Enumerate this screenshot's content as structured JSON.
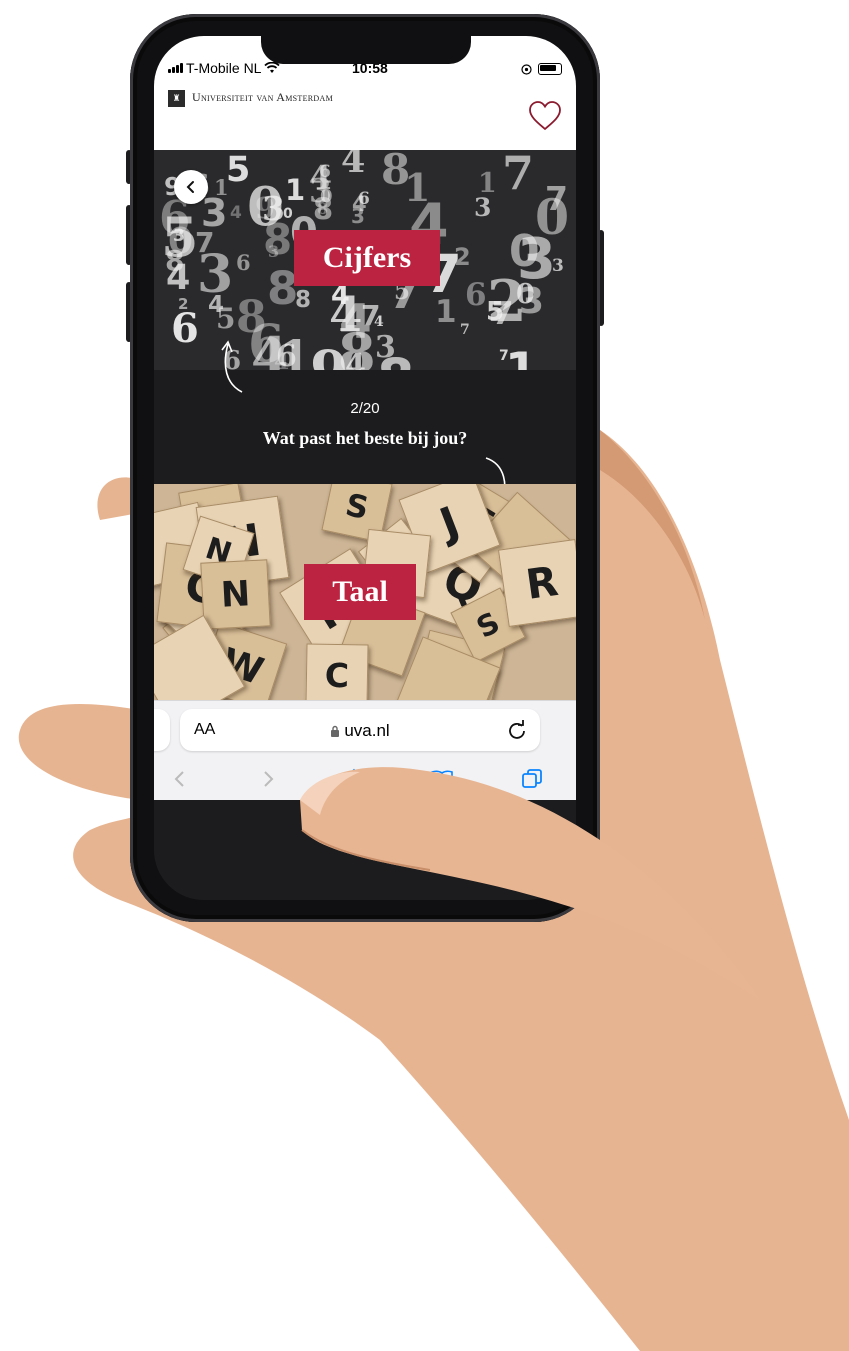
{
  "status_bar": {
    "carrier": "T-Mobile NL",
    "time": "10:58"
  },
  "header": {
    "logo_text": "Universiteit van Amsterdam",
    "logo_mark": "♜",
    "favorite_icon": "heart-icon"
  },
  "quiz": {
    "counter": "2/20",
    "question": "Wat past het beste bij jou?",
    "option_a": {
      "label": "Cijfers",
      "background": "numbers-image"
    },
    "option_b": {
      "label": "Taal",
      "background": "scrabble-tiles-image"
    },
    "back_icon": "chevron-left-icon"
  },
  "browser": {
    "text_size_label": "AA",
    "url": "uva.nl",
    "lock_icon": "lock-icon",
    "reload_icon": "reload-icon",
    "toolbar": [
      "back-icon",
      "forward-icon",
      "share-icon",
      "bookmarks-icon",
      "tabs-icon"
    ]
  },
  "colors": {
    "accent": "#bc2340",
    "dark_bg": "#1c1c1e",
    "link_blue": "#0a84ff"
  }
}
